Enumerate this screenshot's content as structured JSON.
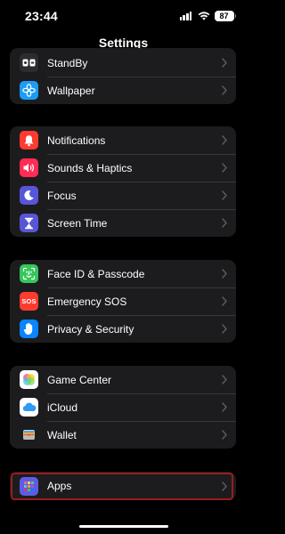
{
  "status_bar": {
    "time": "23:44",
    "battery": "87"
  },
  "header": {
    "title": "Settings"
  },
  "groups": [
    {
      "items": [
        {
          "label": "StandBy",
          "icon": "standby-icon",
          "color": "#2c2c2e"
        },
        {
          "label": "Wallpaper",
          "icon": "wallpaper-icon",
          "color": "#1c9cf6"
        }
      ]
    },
    {
      "items": [
        {
          "label": "Notifications",
          "icon": "notifications-icon",
          "color": "#ff3b30"
        },
        {
          "label": "Sounds & Haptics",
          "icon": "sounds-icon",
          "color": "#ff2d55"
        },
        {
          "label": "Focus",
          "icon": "focus-icon",
          "color": "#5856d6"
        },
        {
          "label": "Screen Time",
          "icon": "screen-time-icon",
          "color": "#5856d6"
        }
      ]
    },
    {
      "items": [
        {
          "label": "Face ID & Passcode",
          "icon": "face-id-icon",
          "color": "#34c759"
        },
        {
          "label": "Emergency SOS",
          "icon": "sos-icon",
          "color": "#ff3b30",
          "icon_text": "SOS"
        },
        {
          "label": "Privacy & Security",
          "icon": "privacy-hand-icon",
          "color": "#0a84ff"
        }
      ]
    },
    {
      "items": [
        {
          "label": "Game Center",
          "icon": "game-center-icon",
          "color": "#ffffff"
        },
        {
          "label": "iCloud",
          "icon": "icloud-icon",
          "color": "#ffffff"
        },
        {
          "label": "Wallet",
          "icon": "wallet-icon",
          "color": "#1c1c1e"
        }
      ]
    },
    {
      "items": [
        {
          "label": "Apps",
          "icon": "apps-grid-icon",
          "color": "#5e5ce6"
        }
      ]
    }
  ],
  "highlight_color": "#9b1c1c"
}
